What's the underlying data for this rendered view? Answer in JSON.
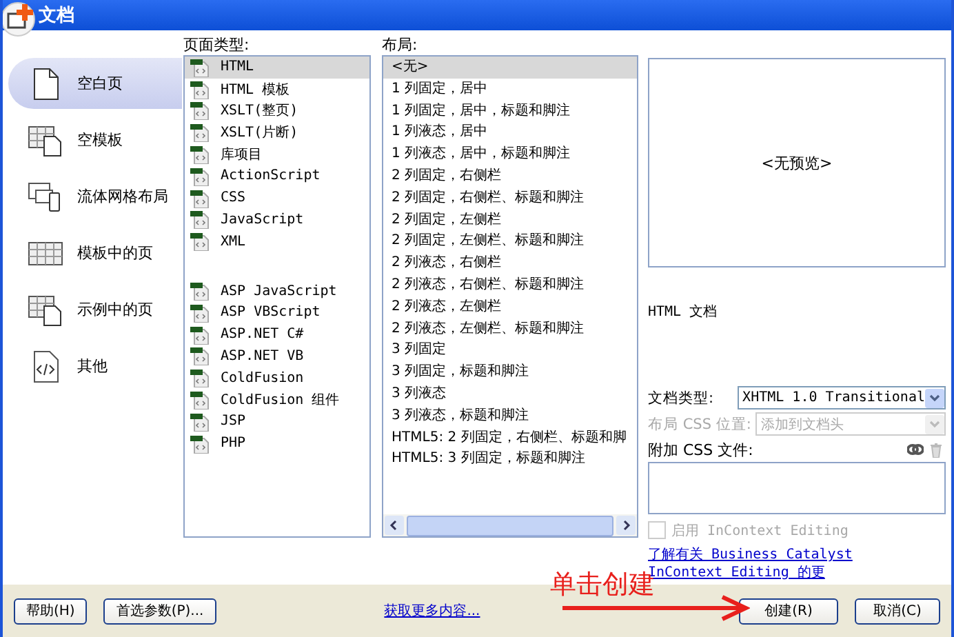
{
  "window": {
    "title": "文档"
  },
  "categories": [
    {
      "label": "空白页",
      "kind": "page",
      "selected": true
    },
    {
      "label": "空模板",
      "kind": "template",
      "selected": false
    },
    {
      "label": "流体网格布局",
      "kind": "devices",
      "selected": false
    },
    {
      "label": "模板中的页",
      "kind": "grid",
      "selected": false
    },
    {
      "label": "示例中的页",
      "kind": "sample",
      "selected": false
    },
    {
      "label": "其他",
      "kind": "code",
      "selected": false
    }
  ],
  "page_type": {
    "label": "页面类型:",
    "groups": [
      [
        {
          "label": "HTML",
          "selected": true
        },
        {
          "label": "HTML 模板",
          "selected": false
        },
        {
          "label": "XSLT(整页)",
          "selected": false
        },
        {
          "label": "XSLT(片断)",
          "selected": false
        },
        {
          "label": "库项目",
          "selected": false
        },
        {
          "label": "ActionScript",
          "selected": false
        },
        {
          "label": "CSS",
          "selected": false
        },
        {
          "label": "JavaScript",
          "selected": false
        },
        {
          "label": "XML",
          "selected": false
        }
      ],
      [
        {
          "label": "ASP JavaScript",
          "selected": false
        },
        {
          "label": "ASP VBScript",
          "selected": false
        },
        {
          "label": "ASP.NET C#",
          "selected": false
        },
        {
          "label": "ASP.NET VB",
          "selected": false
        },
        {
          "label": "ColdFusion",
          "selected": false
        },
        {
          "label": "ColdFusion 组件",
          "selected": false
        },
        {
          "label": "JSP",
          "selected": false
        },
        {
          "label": "PHP",
          "selected": false
        }
      ]
    ]
  },
  "layout": {
    "label": "布局:",
    "items": [
      {
        "label": "<无>",
        "selected": true
      },
      {
        "label": "1 列固定，居中",
        "selected": false
      },
      {
        "label": "1 列固定，居中，标题和脚注",
        "selected": false
      },
      {
        "label": "1 列液态，居中",
        "selected": false
      },
      {
        "label": "1 列液态，居中，标题和脚注",
        "selected": false
      },
      {
        "label": "2 列固定，右侧栏",
        "selected": false
      },
      {
        "label": "2 列固定，右侧栏、标题和脚注",
        "selected": false
      },
      {
        "label": "2 列固定，左侧栏",
        "selected": false
      },
      {
        "label": "2 列固定，左侧栏、标题和脚注",
        "selected": false
      },
      {
        "label": "2 列液态，右侧栏",
        "selected": false
      },
      {
        "label": "2 列液态，右侧栏、标题和脚注",
        "selected": false
      },
      {
        "label": "2 列液态，左侧栏",
        "selected": false
      },
      {
        "label": "2 列液态，左侧栏、标题和脚注",
        "selected": false
      },
      {
        "label": "3 列固定",
        "selected": false
      },
      {
        "label": "3 列固定，标题和脚注",
        "selected": false
      },
      {
        "label": "3 列液态",
        "selected": false
      },
      {
        "label": "3 列液态，标题和脚注",
        "selected": false
      },
      {
        "label": "HTML5: 2 列固定，右侧栏、标题和脚",
        "selected": false
      },
      {
        "label": "HTML5: 3 列固定，标题和脚注",
        "selected": false
      }
    ]
  },
  "preview": {
    "text": "<无预览>"
  },
  "description": "HTML 文档",
  "doc_type": {
    "label": "文档类型:",
    "value": "XHTML 1.0 Transitional",
    "disabled": false
  },
  "layout_css": {
    "label": "布局 CSS 位置:",
    "value": "添加到文档头",
    "disabled": true
  },
  "attach_css": {
    "label": "附加 CSS 文件:"
  },
  "incontext": {
    "label": "启用 InContext Editing",
    "checked": false,
    "disabled": true
  },
  "learn_more": "了解有关 Business Catalyst InContext Editing 的更",
  "buttons": {
    "help": "帮助(H)",
    "prefs": "首选参数(P)...",
    "more": "获取更多内容...",
    "create": "创建(R)",
    "cancel": "取消(C)"
  },
  "annotation": {
    "text": "单击创建"
  }
}
